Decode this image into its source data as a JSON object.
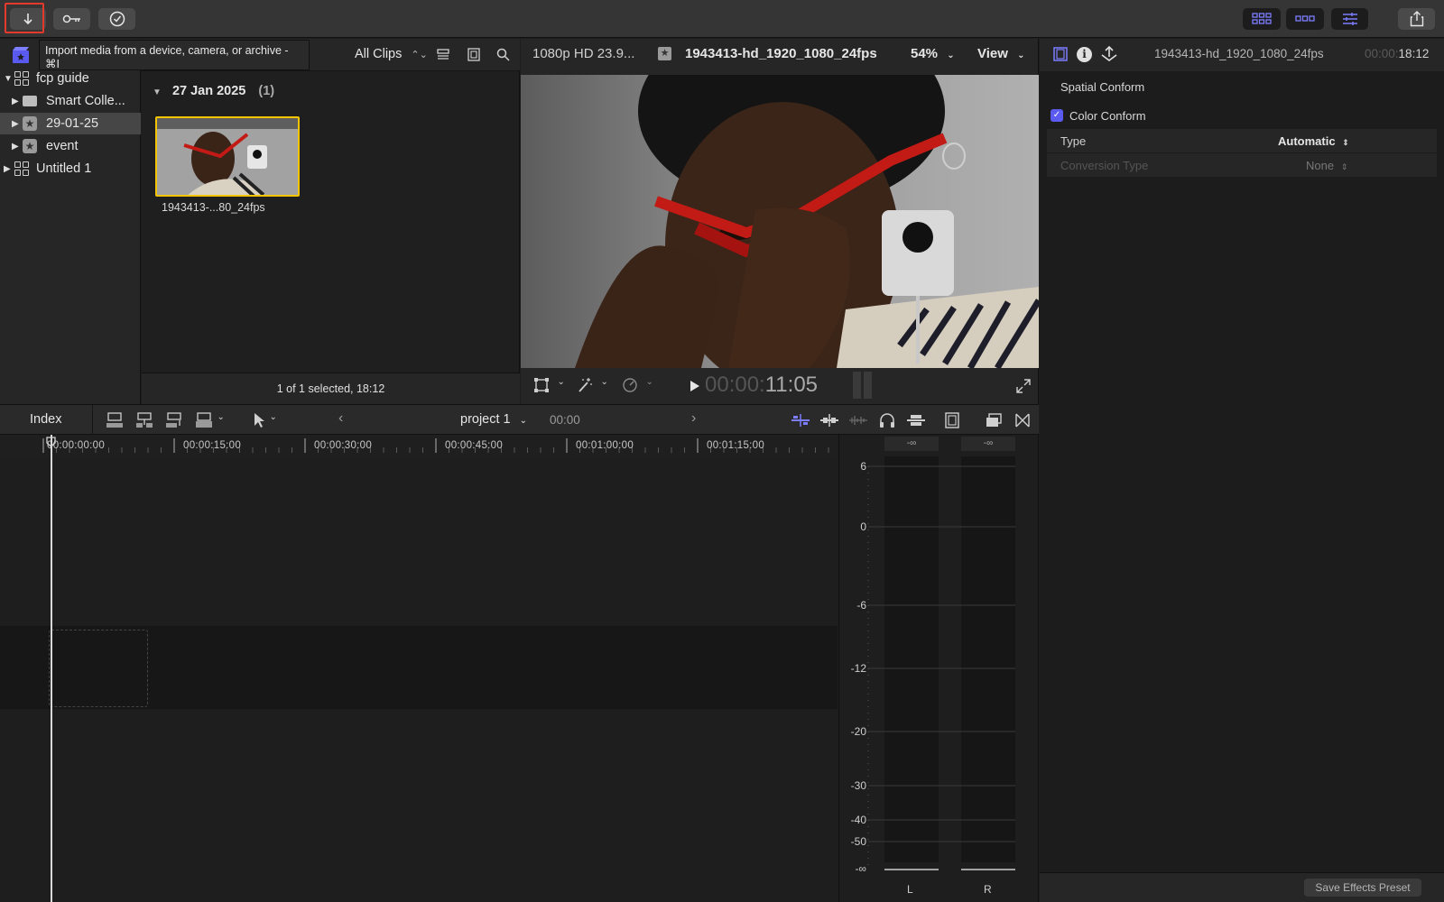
{
  "toolbar": {
    "import_icon": "download-arrow-icon",
    "keyword_icon": "key-icon",
    "bg_tasks_icon": "checkmark-circle-icon",
    "share_icon": "share-icon"
  },
  "tooltip": {
    "text": "Import media from a device, camera, or archive - ⌘I"
  },
  "sidebar": {
    "items": [
      {
        "label": "fcp guide",
        "icon": "library-icon",
        "expanded": true
      },
      {
        "label": "Smart Colle...",
        "icon": "folder-icon"
      },
      {
        "label": "29-01-25",
        "icon": "event-star-icon",
        "selected": true
      },
      {
        "label": "event",
        "icon": "event-star-icon"
      },
      {
        "label": "Untitled 1",
        "icon": "library-icon"
      }
    ]
  },
  "browser": {
    "filter_label": "All Clips",
    "date_group": "27 Jan 2025",
    "date_count": "(1)",
    "clip_name": "1943413-...80_24fps",
    "footer": "1 of 1 selected, 18:12"
  },
  "viewer": {
    "format": "1080p HD 23.9...",
    "clip_title": "1943413-hd_1920_1080_24fps",
    "zoom": "54%",
    "view_label": "View",
    "timecode_dim": "00:00:",
    "timecode_bright": "11:05"
  },
  "inspector": {
    "clip_title": "1943413-hd_1920_1080_24fps",
    "duration_dim": "00:00:",
    "duration_bright": "18:12",
    "spatial_conform": "Spatial Conform",
    "color_conform": "Color Conform",
    "color_conform_checked": true,
    "type_label": "Type",
    "type_value": "Automatic",
    "conversion_label": "Conversion Type",
    "conversion_value": "None",
    "save_preset": "Save Effects Preset"
  },
  "timeline": {
    "index_label": "Index",
    "project_name": "project 1",
    "project_time": "00:00",
    "ruler_ticks": [
      "00:00:00:00",
      "00:00:15:00",
      "00:00:30:00",
      "00:00:45:00",
      "00:01:00:00",
      "00:01:15:00"
    ]
  },
  "meter": {
    "peak_l": "-∞",
    "peak_r": "-∞",
    "scale": [
      "6",
      "0",
      "-6",
      "-12",
      "-20",
      "-30",
      "-40",
      "-50",
      "-∞"
    ],
    "channel_l": "L",
    "channel_r": "R"
  },
  "colors": {
    "accent": "#7d7dff",
    "selection": "#f5c400",
    "highlight": "#e53a2b"
  }
}
